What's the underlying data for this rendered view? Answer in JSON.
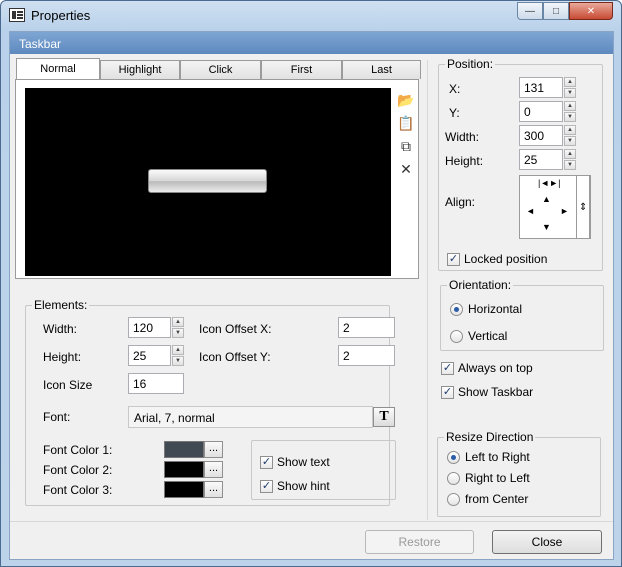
{
  "window": {
    "title": "Properties",
    "controls": {
      "minimize": "—",
      "maximize": "□",
      "close": "✕"
    }
  },
  "header": {
    "title": "Taskbar"
  },
  "tabs": [
    {
      "label": "Normal",
      "active": true
    },
    {
      "label": "Highlight",
      "active": false
    },
    {
      "label": "Click",
      "active": false
    },
    {
      "label": "First",
      "active": false
    },
    {
      "label": "Last",
      "active": false
    }
  ],
  "preview_tools": [
    {
      "name": "open-folder-icon",
      "glyph": "📂"
    },
    {
      "name": "paste-icon",
      "glyph": "📋"
    },
    {
      "name": "copy-icon",
      "glyph": "⧉"
    },
    {
      "name": "delete-icon",
      "glyph": "✕"
    }
  ],
  "elements": {
    "legend": "Elements:",
    "width_label": "Width:",
    "width_value": "120",
    "height_label": "Height:",
    "height_value": "25",
    "icon_size_label": "Icon Size",
    "icon_size_value": "16",
    "icon_offset_x_label": "Icon Offset X:",
    "icon_offset_x_value": "2",
    "icon_offset_y_label": "Icon Offset Y:",
    "icon_offset_y_value": "2",
    "font_label": "Font:",
    "font_value": "Arial, 7, normal",
    "font_button": "T",
    "font_color_1_label": "Font Color 1:",
    "font_color_1": "#414a52",
    "font_color_2_label": "Font Color 2:",
    "font_color_2": "#000000",
    "font_color_3_label": "Font Color 3:",
    "font_color_3": "#000000",
    "dots": "...",
    "show_text_label": "Show text",
    "show_text": true,
    "show_hint_label": "Show hint",
    "show_hint": true
  },
  "position": {
    "legend": "Position:",
    "x_label": "X:",
    "x_value": "131",
    "y_label": "Y:",
    "y_value": "0",
    "width_label": "Width:",
    "width_value": "300",
    "height_label": "Height:",
    "height_value": "25",
    "align_label": "Align:",
    "locked_label": "Locked position",
    "locked": true
  },
  "orientation": {
    "legend": "Orientation:",
    "options": [
      "Horizontal",
      "Vertical"
    ],
    "selected": "Horizontal"
  },
  "always_on_top_label": "Always on top",
  "always_on_top": true,
  "show_taskbar_label": "Show Taskbar",
  "show_taskbar": true,
  "resize_direction": {
    "legend": "Resize Direction",
    "options": [
      "Left to Right",
      "Right to Left",
      "from Center"
    ],
    "selected": "Left to Right"
  },
  "footer": {
    "restore_label": "Restore",
    "close_label": "Close"
  },
  "colors": {
    "header": "#6a93c6",
    "preview_bg": "#000000"
  }
}
